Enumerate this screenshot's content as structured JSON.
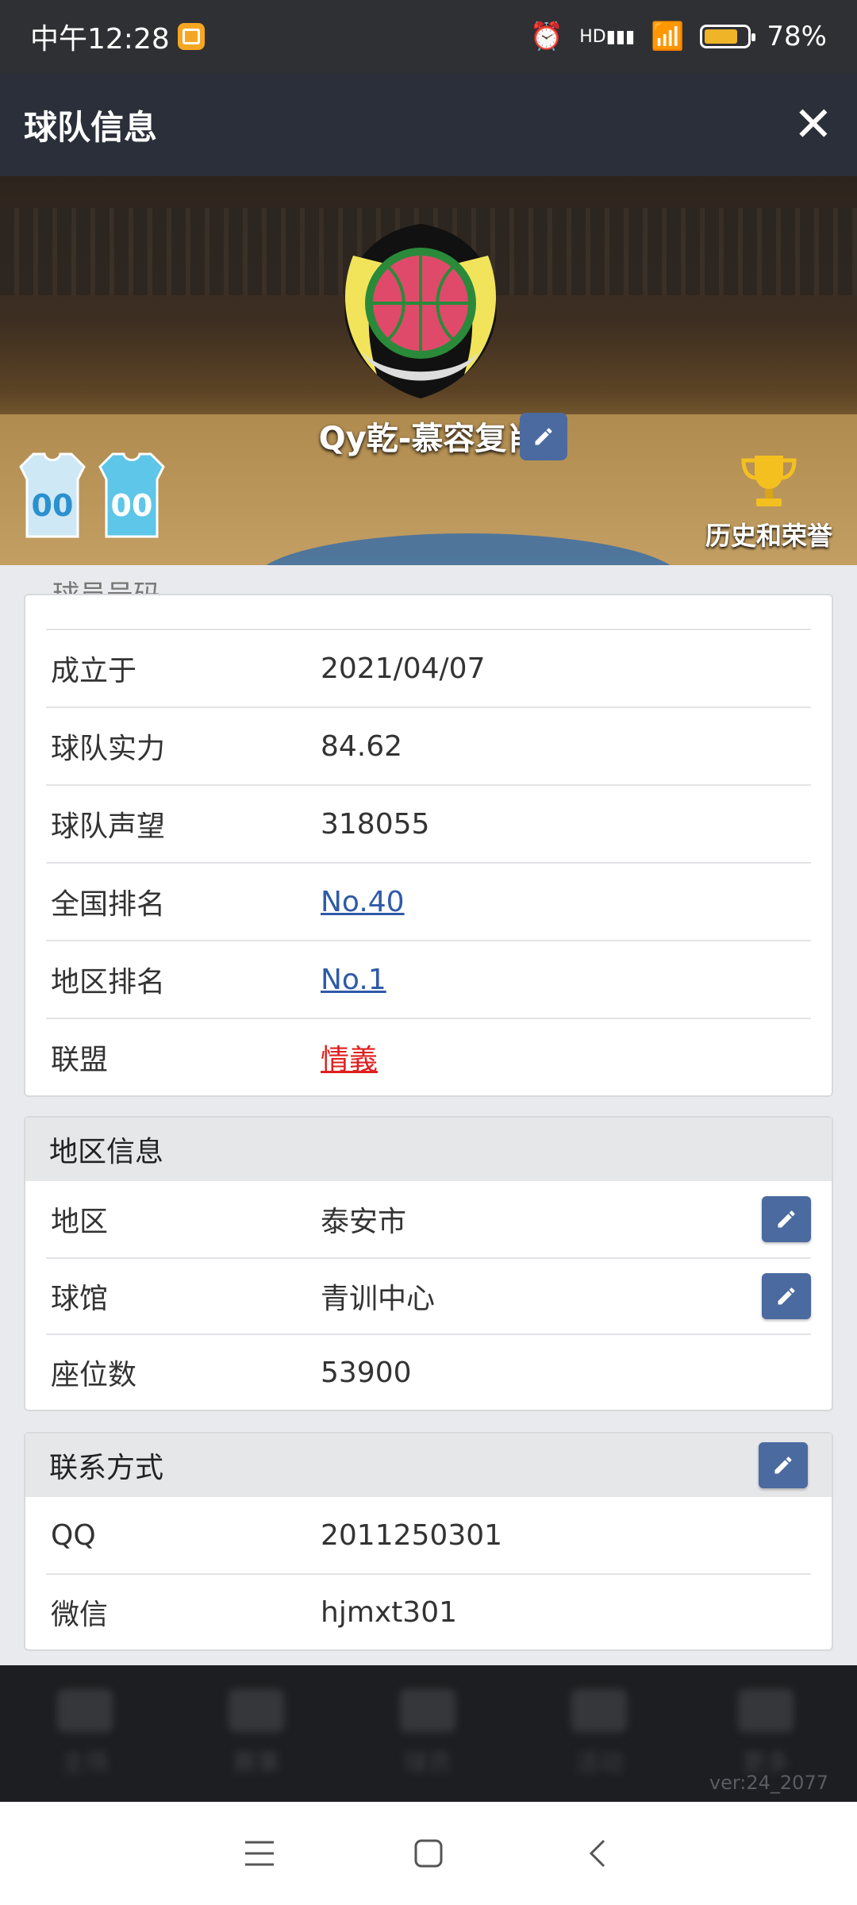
{
  "status": {
    "time": "中午12:28",
    "network": "HD",
    "battery": "78%",
    "battery_level": 0.78
  },
  "header": {
    "title": "球队信息",
    "close": "✕"
  },
  "banner": {
    "team_name": "Qy乾-慕容复肖",
    "jersey_numbers": [
      "00",
      "00"
    ],
    "honor_label": "历史和荣誉"
  },
  "basic_info": {
    "cut_header": "球员号码",
    "rows": [
      {
        "key": "成立于",
        "value": "2021/04/07"
      },
      {
        "key": "球队实力",
        "value": "84.62"
      },
      {
        "key": "球队声望",
        "value": "318055"
      },
      {
        "key": "全国排名",
        "value": "No.40"
      },
      {
        "key": "地区排名",
        "value": "No.1"
      },
      {
        "key": "联盟",
        "value": "情義"
      }
    ]
  },
  "region_info": {
    "title": "地区信息",
    "rows": [
      {
        "key": "地区",
        "value": "泰安市"
      },
      {
        "key": "球馆",
        "value": "青训中心"
      },
      {
        "key": "座位数",
        "value": "53900"
      }
    ]
  },
  "contact_info": {
    "title": "联系方式",
    "rows": [
      {
        "key": "QQ",
        "value": "2011250301"
      },
      {
        "key": "微信",
        "value": "hjmxt301"
      }
    ]
  },
  "bottom_nav": {
    "items": [
      "主场",
      "赛事",
      "球员",
      "活动",
      "更多"
    ],
    "version": "ver:24_2077"
  },
  "colors": {
    "accent": "#4b6aa0",
    "link": "#2e5aa8",
    "alliance": "#e01f1f",
    "header_bg": "#2a2f39"
  }
}
